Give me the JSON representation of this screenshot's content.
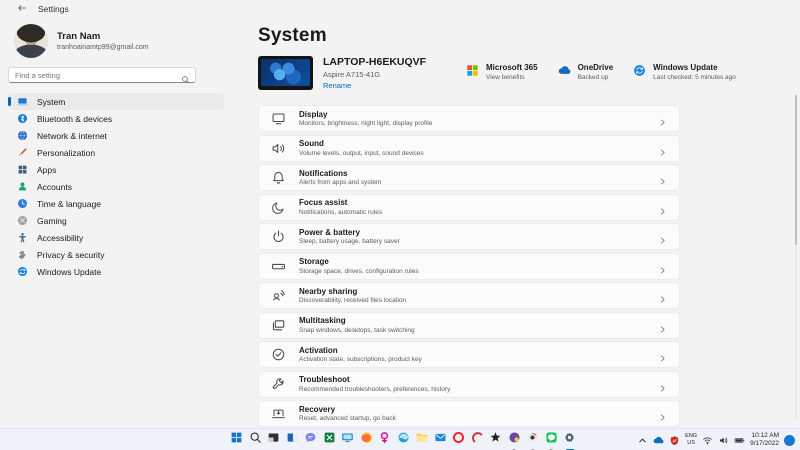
{
  "colors": {
    "accent": "#0067c0"
  },
  "window": {
    "title": "Settings"
  },
  "profile": {
    "name": "Tran Nam",
    "email": "tranhoainamtp99@gmail.com"
  },
  "search": {
    "placeholder": "Find a setting"
  },
  "sidebar": {
    "items": [
      {
        "icon": "system-icon",
        "label": "System",
        "active": true
      },
      {
        "icon": "bluetooth-icon",
        "label": "Bluetooth & devices"
      },
      {
        "icon": "network-icon",
        "label": "Network & internet"
      },
      {
        "icon": "personalization-icon",
        "label": "Personalization"
      },
      {
        "icon": "apps-icon",
        "label": "Apps"
      },
      {
        "icon": "accounts-icon",
        "label": "Accounts"
      },
      {
        "icon": "time-language-icon",
        "label": "Time & language"
      },
      {
        "icon": "gaming-icon",
        "label": "Gaming"
      },
      {
        "icon": "accessibility-icon",
        "label": "Accessibility"
      },
      {
        "icon": "privacy-security-icon",
        "label": "Privacy & security"
      },
      {
        "icon": "windows-update-icon",
        "label": "Windows Update"
      }
    ]
  },
  "main": {
    "title": "System",
    "device": {
      "name": "LAPTOP-H6EKUQVF",
      "model": "Aspire A715-41G",
      "rename_label": "Rename"
    },
    "status_items": [
      {
        "icon": "microsoft-365-icon",
        "title": "Microsoft 365",
        "subtitle": "View benefits"
      },
      {
        "icon": "onedrive-icon",
        "title": "OneDrive",
        "subtitle": "Backed up"
      },
      {
        "icon": "windows-update-icon",
        "title": "Windows Update",
        "subtitle": "Last checked: 5 minutes ago"
      }
    ],
    "rows": [
      {
        "icon": "display-icon",
        "title": "Display",
        "subtitle": "Monitors, brightness, night light, display profile"
      },
      {
        "icon": "sound-icon",
        "title": "Sound",
        "subtitle": "Volume levels, output, input, sound devices"
      },
      {
        "icon": "notifications-icon",
        "title": "Notifications",
        "subtitle": "Alerts from apps and system"
      },
      {
        "icon": "focus-assist-icon",
        "title": "Focus assist",
        "subtitle": "Notifications, automatic rules"
      },
      {
        "icon": "power-battery-icon",
        "title": "Power & battery",
        "subtitle": "Sleep, battery usage, battery saver"
      },
      {
        "icon": "storage-icon",
        "title": "Storage",
        "subtitle": "Storage space, drives, configuration rules"
      },
      {
        "icon": "nearby-sharing-icon",
        "title": "Nearby sharing",
        "subtitle": "Discoverability, received files location"
      },
      {
        "icon": "multitasking-icon",
        "title": "Multitasking",
        "subtitle": "Snap windows, desktops, task switching"
      },
      {
        "icon": "activation-icon",
        "title": "Activation",
        "subtitle": "Activation state, subscriptions, product key"
      },
      {
        "icon": "troubleshoot-icon",
        "title": "Troubleshoot",
        "subtitle": "Recommended troubleshooters, preferences, history"
      },
      {
        "icon": "recovery-icon",
        "title": "Recovery",
        "subtitle": "Reset, advanced startup, go back"
      }
    ]
  },
  "taskbar": {
    "icons": [
      {
        "icon": "start-icon"
      },
      {
        "icon": "search-taskbar-icon"
      },
      {
        "icon": "dark-app-icon"
      },
      {
        "icon": "panels-app-icon"
      },
      {
        "icon": "teams-chat-icon"
      },
      {
        "icon": "excel-icon"
      },
      {
        "icon": "monitor-app-icon"
      },
      {
        "icon": "firefox-icon"
      },
      {
        "icon": "pink-app-icon"
      },
      {
        "icon": "edge-icon"
      },
      {
        "icon": "file-explorer-icon"
      },
      {
        "icon": "mail-icon"
      },
      {
        "icon": "opera-icon"
      },
      {
        "icon": "red-c-app-icon"
      },
      {
        "icon": "black-star-app-icon"
      },
      {
        "icon": "purple-app-icon",
        "running": true
      },
      {
        "icon": "round-app-icon",
        "running": true
      },
      {
        "icon": "line-icon",
        "running": true
      },
      {
        "icon": "settings-gear-icon",
        "active": true
      }
    ],
    "tray": {
      "language_line1": "ENG",
      "language_line2": "US",
      "time": "10:12 AM",
      "date": "9/17/2022"
    }
  }
}
